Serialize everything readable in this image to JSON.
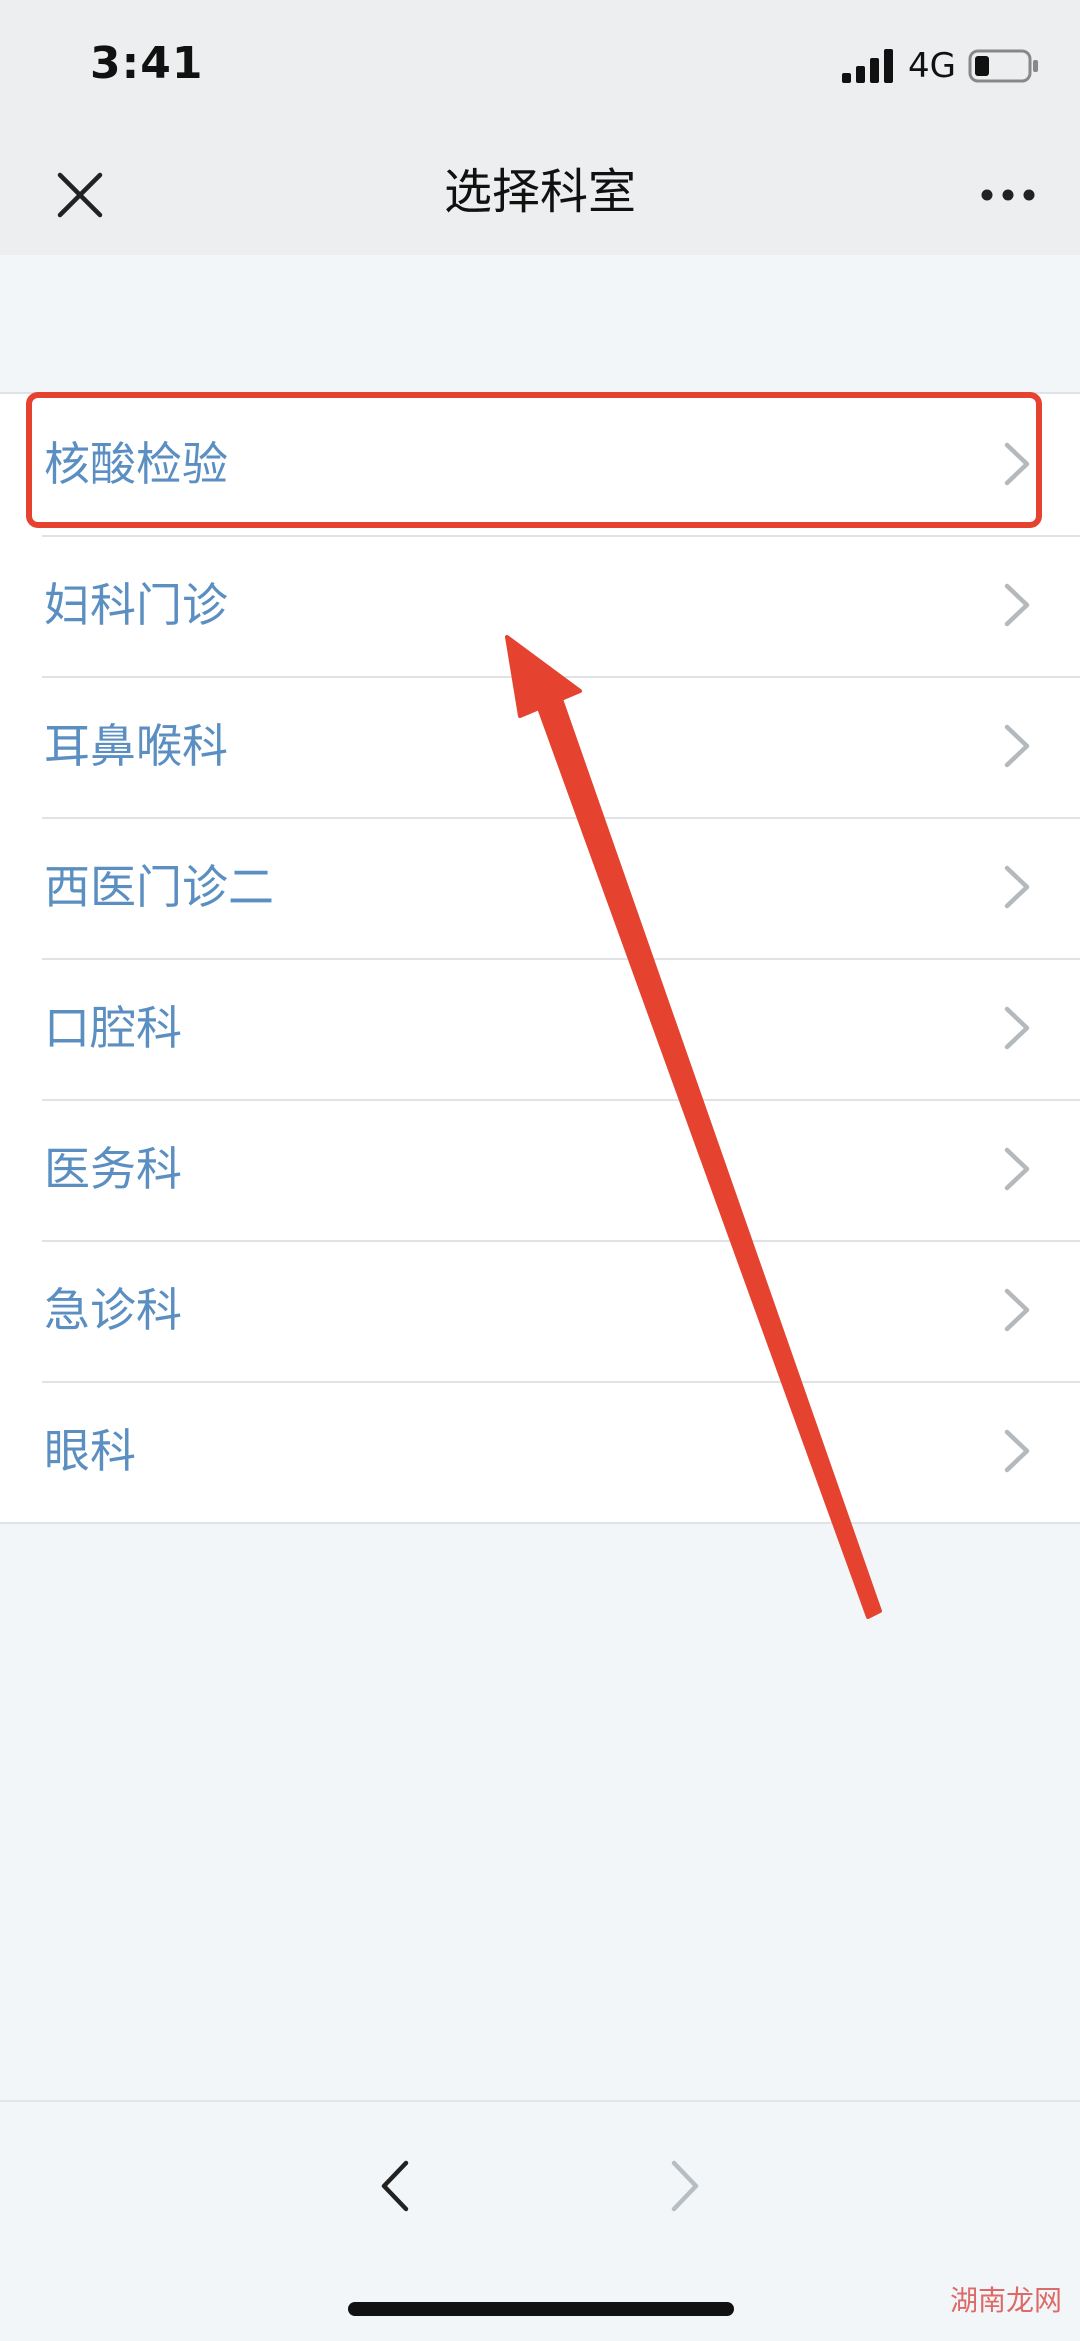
{
  "status_bar": {
    "time": "3:41",
    "network": "4G",
    "signal_icon": "signal-bars-icon",
    "battery_icon": "battery-low-icon"
  },
  "nav": {
    "title": "选择科室",
    "close_icon": "close-icon",
    "more_icon": "more-horizontal-icon"
  },
  "departments": [
    {
      "label": "核酸检验"
    },
    {
      "label": "妇科门诊"
    },
    {
      "label": "耳鼻喉科"
    },
    {
      "label": "西医门诊二"
    },
    {
      "label": "口腔科"
    },
    {
      "label": "医务科"
    },
    {
      "label": "急诊科"
    },
    {
      "label": "眼科"
    }
  ],
  "toolbar": {
    "back_icon": "chevron-left-icon",
    "forward_icon": "chevron-right-icon",
    "forward_enabled": false
  },
  "watermark": "湖南龙网",
  "colors": {
    "item_text": "#5b8fc2",
    "annotation": "#e54330",
    "nav_background": "#eceeef",
    "page_background": "#f3f6f8"
  }
}
